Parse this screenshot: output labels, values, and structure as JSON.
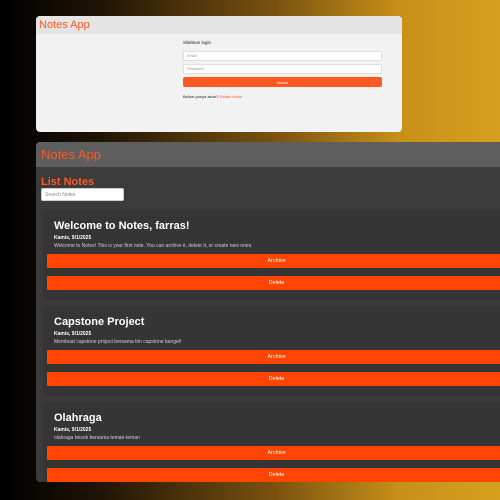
{
  "login_window": {
    "app_title": "Notes App",
    "prompt": "Silahkan login",
    "email_placeholder": "Email",
    "password_placeholder": "Password",
    "submit_label": "Masuk",
    "register_prompt": "Belum punya akun?",
    "register_link": "Daftar di sini"
  },
  "notes_window": {
    "app_title": "Notes App",
    "list_title": "List Notes",
    "search_placeholder": "Search Notes",
    "notes": [
      {
        "title": "Welcome to Notes, farras!",
        "date": "Kamis, 9/1/2025",
        "body": "Welcome to Notes! This is your first note. You can archive it, delete it, or create new ones.",
        "archive_label": "Archive",
        "delete_label": "Delete"
      },
      {
        "title": "Capstone Project",
        "date": "Kamis, 9/1/2025",
        "body": "Membuat capstone project bersama tim capstone banget!",
        "archive_label": "Archive",
        "delete_label": "Delete"
      },
      {
        "title": "Olahraga",
        "date": "Kamis, 9/1/2025",
        "body": "olahraga besok bersama teman-teman",
        "archive_label": "Archive",
        "delete_label": "Delete"
      }
    ]
  },
  "colors": {
    "accent": "#ff5722",
    "button": "#ff4500",
    "dark_window": "#3b3b3b",
    "dark_header": "#5e5e5e"
  }
}
